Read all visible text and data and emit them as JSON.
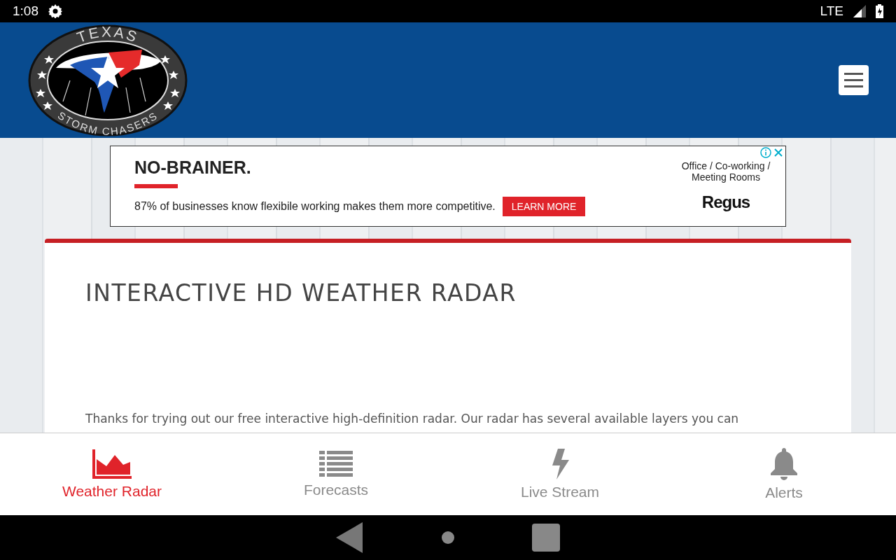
{
  "status_bar": {
    "time": "1:08",
    "network": "LTE"
  },
  "header": {
    "logo_top": "TEXAS",
    "logo_bottom": "STORM CHASERS"
  },
  "ad": {
    "headline": "NO-BRAINER.",
    "body": "87% of businesses know flexibile working makes them more competitive.",
    "button": "LEARN MORE",
    "tagline": "Office / Co-working / Meeting Rooms",
    "brand": "Regus"
  },
  "card": {
    "title": "INTERACTIVE HD WEATHER RADAR",
    "paragraph": "Thanks for trying out our free interactive high-definition radar. Our radar has several available layers you can"
  },
  "bottom_nav": [
    {
      "label": "Weather Radar",
      "kind": "chart",
      "selected": true
    },
    {
      "label": "Forecasts",
      "kind": "list",
      "selected": false
    },
    {
      "label": "Live Stream",
      "kind": "bolt",
      "selected": false
    },
    {
      "label": "Alerts",
      "kind": "bell",
      "selected": false
    }
  ]
}
